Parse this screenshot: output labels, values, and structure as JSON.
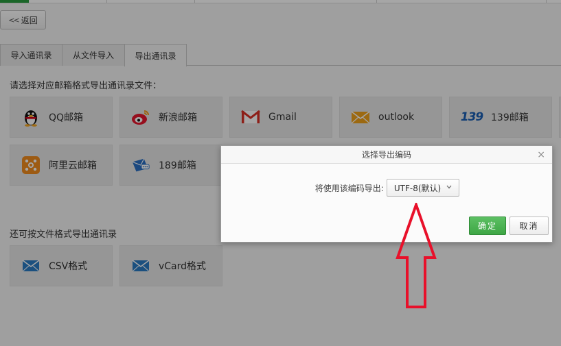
{
  "nav": {
    "back_label": "返回",
    "back_chevron": "<<"
  },
  "tabs": [
    {
      "label": "导入通讯录",
      "active": false
    },
    {
      "label": "从文件导入",
      "active": false
    },
    {
      "label": "导出通讯录",
      "active": true
    }
  ],
  "mail_section": {
    "label": "请选择对应邮箱格式导出通讯录文件：",
    "items": [
      {
        "label": "QQ邮箱",
        "icon": "qq-penguin-icon"
      },
      {
        "label": "新浪邮箱",
        "icon": "sina-weibo-icon"
      },
      {
        "label": "Gmail",
        "icon": "gmail-icon"
      },
      {
        "label": "outlook",
        "icon": "outlook-envelope-icon"
      },
      {
        "label": "139邮箱",
        "icon": "139-logo-icon",
        "logo_text": "139"
      },
      {
        "label": "阿里云邮箱",
        "icon": "aliyun-icon"
      },
      {
        "label": "189邮箱",
        "icon": "189-mail-icon"
      }
    ]
  },
  "file_section": {
    "label": "还可按文件格式导出通讯录",
    "items": [
      {
        "label": "CSV格式",
        "icon": "envelope-icon"
      },
      {
        "label": "vCard格式",
        "icon": "envelope-icon"
      }
    ]
  },
  "dialog": {
    "title": "选择导出编码",
    "close_glyph": "×",
    "encoding_label": "将使用该编码导出:",
    "encoding_value": "UTF-8(默认)",
    "ok_label": "确定",
    "cancel_label": "取消"
  },
  "colors": {
    "accent_green": "#3ea645",
    "annotation_red": "#e8102a",
    "icon_blue": "#2a7bc4"
  }
}
